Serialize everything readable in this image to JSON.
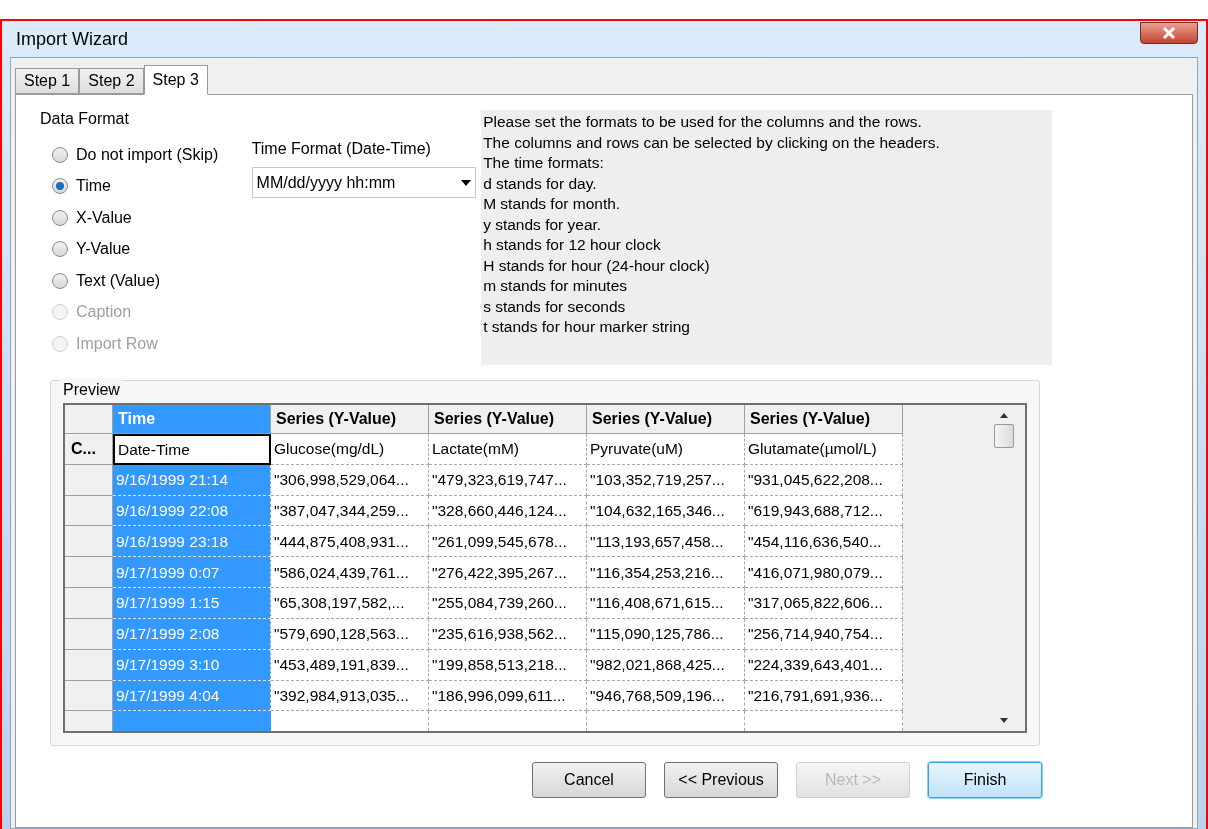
{
  "window": {
    "title": "Import Wizard"
  },
  "tabs": [
    {
      "label": "Step 1",
      "selected": false
    },
    {
      "label": "Step 2",
      "selected": false
    },
    {
      "label": "Step 3",
      "selected": true
    }
  ],
  "data_format": {
    "label": "Data Format",
    "options": [
      {
        "label": "Do not import (Skip)",
        "selected": false,
        "disabled": false
      },
      {
        "label": "Time",
        "selected": true,
        "disabled": false
      },
      {
        "label": "X-Value",
        "selected": false,
        "disabled": false
      },
      {
        "label": "Y-Value",
        "selected": false,
        "disabled": false
      },
      {
        "label": "Text (Value)",
        "selected": false,
        "disabled": false
      },
      {
        "label": "Caption",
        "selected": false,
        "disabled": true
      },
      {
        "label": "Import Row",
        "selected": false,
        "disabled": true
      }
    ]
  },
  "time_format": {
    "label": "Time Format (Date-Time)",
    "value": "MM/dd/yyyy hh:mm"
  },
  "help_lines": [
    "Please set the formats to be used for the columns and the rows.",
    "The columns and rows can be selected by clicking on the headers.",
    "The time formats:",
    "d stands for day.",
    "M stands for month.",
    "y stands for year.",
    "h stands for 12 hour clock",
    "H stands for hour (24-hour clock)",
    "m stands for minutes",
    "s stands for seconds",
    "t stands for hour marker string"
  ],
  "preview": {
    "label": "Preview",
    "columns": [
      {
        "header": "Time",
        "selected": true
      },
      {
        "header": "Series (Y-Value)",
        "selected": false
      },
      {
        "header": "Series (Y-Value)",
        "selected": false
      },
      {
        "header": "Series (Y-Value)",
        "selected": false
      },
      {
        "header": "Series (Y-Value)",
        "selected": false
      }
    ],
    "name_row": {
      "row_header": "C...",
      "cells": [
        "Date-Time",
        "Glucose(mg/dL)",
        "Lactate(mM)",
        "Pyruvate(uM)",
        "Glutamate(µmol/L)"
      ]
    },
    "rows": [
      {
        "cells": [
          "9/16/1999 21:14",
          "\"306,998,529,064...",
          "\"479,323,619,747...",
          "\"103,352,719,257...",
          "\"931,045,622,208..."
        ]
      },
      {
        "cells": [
          "9/16/1999 22:08",
          "\"387,047,344,259...",
          "\"328,660,446,124...",
          "\"104,632,165,346...",
          "\"619,943,688,712..."
        ]
      },
      {
        "cells": [
          "9/16/1999 23:18",
          "\"444,875,408,931...",
          "\"261,099,545,678...",
          "\"113,193,657,458...",
          "\"454,116,636,540..."
        ]
      },
      {
        "cells": [
          "9/17/1999 0:07",
          "\"586,024,439,761...",
          "\"276,422,395,267...",
          "\"116,354,253,216...",
          "\"416,071,980,079..."
        ]
      },
      {
        "cells": [
          "9/17/1999 1:15",
          "\"65,308,197,582,...",
          "\"255,084,739,260...",
          "\"116,408,671,615...",
          "\"317,065,822,606..."
        ]
      },
      {
        "cells": [
          "9/17/1999 2:08",
          "\"579,690,128,563...",
          "\"235,616,938,562...",
          "\"115,090,125,786...",
          "\"256,714,940,754..."
        ]
      },
      {
        "cells": [
          "9/17/1999 3:10",
          "\"453,489,191,839...",
          "\"199,858,513,218...",
          "\"982,021,868,425...",
          "\"224,339,643,401..."
        ]
      },
      {
        "cells": [
          "9/17/1999 4:04",
          "\"392,984,913,035...",
          "\"186,996,099,611...",
          "\"946,768,509,196...",
          "\"216,791,691,936..."
        ]
      }
    ]
  },
  "buttons": [
    {
      "label": "Cancel",
      "disabled": false,
      "default": false
    },
    {
      "label": "<< Previous",
      "disabled": false,
      "default": false
    },
    {
      "label": "Next >>",
      "disabled": true,
      "default": false
    },
    {
      "label": "Finish",
      "disabled": false,
      "default": true
    }
  ]
}
